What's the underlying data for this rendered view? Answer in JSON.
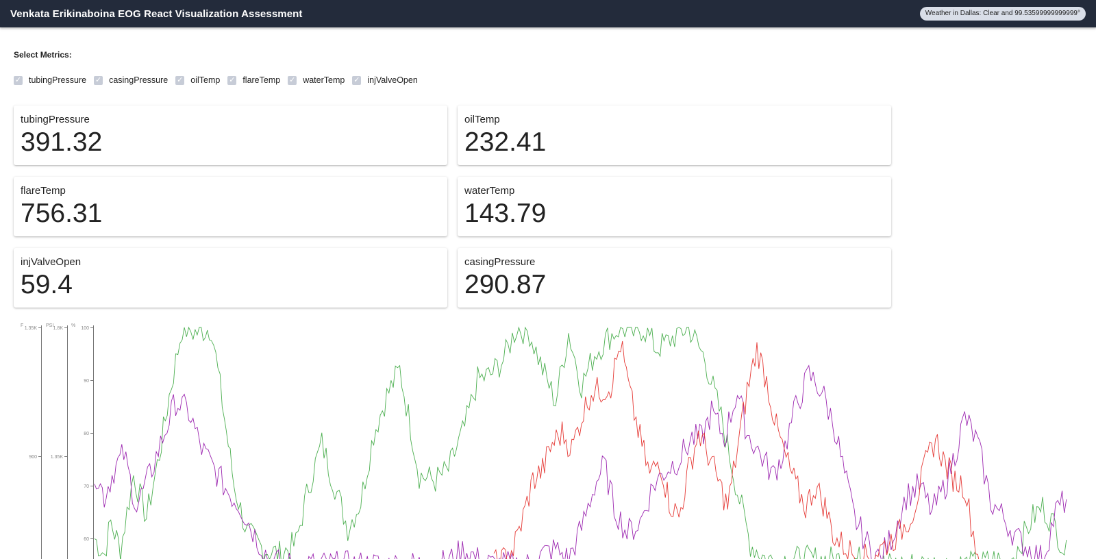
{
  "header": {
    "title": "Venkata Erikinaboina EOG React Visualization Assessment",
    "weather": "Weather in Dallas: Clear and 99.53599999999999°"
  },
  "metric_selector": {
    "label": "Select Metrics:",
    "options": [
      {
        "label": "tubingPressure",
        "checked": true
      },
      {
        "label": "casingPressure",
        "checked": true
      },
      {
        "label": "oilTemp",
        "checked": true
      },
      {
        "label": "flareTemp",
        "checked": true
      },
      {
        "label": "waterTemp",
        "checked": true
      },
      {
        "label": "injValveOpen",
        "checked": true
      }
    ]
  },
  "cards": [
    {
      "title": "tubingPressure",
      "value": "391.32"
    },
    {
      "title": "oilTemp",
      "value": "232.41"
    },
    {
      "title": "flareTemp",
      "value": "756.31"
    },
    {
      "title": "waterTemp",
      "value": "143.79"
    },
    {
      "title": "injValveOpen",
      "value": "59.4"
    },
    {
      "title": "casingPressure",
      "value": "290.87"
    }
  ],
  "colors": {
    "header_bg": "#232b3b",
    "checkbox": "#c7ccd7",
    "series_green": "#4caf50",
    "series_purple": "#9c27b0",
    "series_red": "#e53935"
  },
  "chart_data": {
    "type": "line",
    "axes": [
      {
        "unit": "F",
        "ticks": [
          "1.35K",
          "900"
        ]
      },
      {
        "unit": "PSI",
        "ticks": [
          "1.8K",
          "1.35K"
        ]
      },
      {
        "unit": "%",
        "ticks": [
          "100",
          "90",
          "80",
          "70",
          "60"
        ],
        "ylim": [
          55,
          100
        ]
      }
    ],
    "series": [
      {
        "color": "green",
        "anchors": [
          [
            0,
            60
          ],
          [
            3,
            57
          ],
          [
            5,
            63
          ],
          [
            8,
            58
          ],
          [
            12,
            72
          ],
          [
            16,
            64
          ],
          [
            20,
            76
          ],
          [
            23,
            87
          ],
          [
            27,
            100
          ],
          [
            31,
            99
          ],
          [
            36,
            100
          ],
          [
            40,
            83
          ],
          [
            43,
            70
          ],
          [
            47,
            61
          ],
          [
            52,
            58
          ],
          [
            57,
            57
          ],
          [
            62,
            59
          ],
          [
            66,
            70
          ],
          [
            70,
            78
          ],
          [
            74,
            70
          ],
          [
            78,
            62
          ],
          [
            82,
            67
          ],
          [
            86,
            80
          ],
          [
            90,
            87
          ],
          [
            94,
            92
          ],
          [
            98,
            79
          ],
          [
            100,
            72
          ],
          [
            105,
            71
          ],
          [
            109,
            73
          ],
          [
            114,
            81
          ],
          [
            118,
            90
          ],
          [
            122,
            91
          ],
          [
            126,
            94
          ],
          [
            130,
            100
          ],
          [
            134,
            99
          ],
          [
            138,
            92
          ],
          [
            142,
            86
          ],
          [
            146,
            99
          ],
          [
            150,
            89
          ],
          [
            154,
            95
          ],
          [
            158,
            98
          ],
          [
            162,
            100
          ],
          [
            166,
            99
          ],
          [
            169,
            100
          ],
          [
            173,
            96
          ],
          [
            176,
            97
          ],
          [
            180,
            99
          ],
          [
            183,
            100
          ],
          [
            188,
            94
          ],
          [
            193,
            83
          ],
          [
            198,
            69
          ],
          [
            202,
            59
          ],
          [
            207,
            56
          ],
          [
            212,
            56
          ],
          [
            217,
            56
          ],
          [
            222,
            56
          ],
          [
            228,
            56
          ],
          [
            233,
            56
          ],
          [
            238,
            56
          ],
          [
            243,
            55
          ],
          [
            248,
            55
          ],
          [
            253,
            55
          ],
          [
            258,
            55
          ],
          [
            263,
            55
          ],
          [
            268,
            55
          ],
          [
            273,
            55
          ],
          [
            277,
            56
          ],
          [
            281,
            55
          ],
          [
            285,
            59
          ],
          [
            289,
            64
          ],
          [
            292,
            66
          ],
          [
            296,
            62
          ],
          [
            300,
            56
          ]
        ]
      },
      {
        "color": "purple",
        "anchors": [
          [
            0,
            73
          ],
          [
            3,
            68
          ],
          [
            6,
            73
          ],
          [
            9,
            76
          ],
          [
            13,
            66
          ],
          [
            17,
            72
          ],
          [
            21,
            79
          ],
          [
            25,
            86
          ],
          [
            29,
            84
          ],
          [
            33,
            77
          ],
          [
            37,
            73
          ],
          [
            41,
            69
          ],
          [
            45,
            66
          ],
          [
            50,
            60
          ],
          [
            54,
            56
          ],
          [
            58,
            55
          ],
          [
            62,
            55
          ],
          [
            66,
            55
          ],
          [
            70,
            55
          ],
          [
            74,
            55
          ],
          [
            78,
            55
          ],
          [
            82,
            55
          ],
          [
            86,
            55
          ],
          [
            90,
            55
          ],
          [
            94,
            55
          ],
          [
            98,
            55
          ],
          [
            102,
            55
          ],
          [
            106,
            55
          ],
          [
            110,
            56
          ],
          [
            114,
            58
          ],
          [
            118,
            56
          ],
          [
            122,
            55
          ],
          [
            126,
            55
          ],
          [
            130,
            55
          ],
          [
            134,
            55
          ],
          [
            138,
            57
          ],
          [
            142,
            58
          ],
          [
            146,
            56
          ],
          [
            150,
            62
          ],
          [
            154,
            70
          ],
          [
            157,
            74
          ],
          [
            160,
            66
          ],
          [
            164,
            61
          ],
          [
            168,
            63
          ],
          [
            172,
            70
          ],
          [
            176,
            73
          ],
          [
            180,
            75
          ],
          [
            184,
            79
          ],
          [
            187,
            79
          ],
          [
            190,
            84
          ],
          [
            194,
            79
          ],
          [
            198,
            88
          ],
          [
            201,
            80
          ],
          [
            205,
            76
          ],
          [
            209,
            72
          ],
          [
            212,
            76
          ],
          [
            216,
            85
          ],
          [
            220,
            91
          ],
          [
            224,
            88
          ],
          [
            228,
            81
          ],
          [
            231,
            72
          ],
          [
            234,
            64
          ],
          [
            238,
            59
          ],
          [
            242,
            56
          ],
          [
            246,
            61
          ],
          [
            250,
            68
          ],
          [
            254,
            70
          ],
          [
            258,
            65
          ],
          [
            262,
            70
          ],
          [
            265,
            76
          ],
          [
            268,
            83
          ],
          [
            272,
            78
          ],
          [
            276,
            67
          ],
          [
            280,
            64
          ],
          [
            284,
            60
          ],
          [
            288,
            58
          ],
          [
            292,
            56
          ],
          [
            296,
            65
          ],
          [
            300,
            68
          ]
        ]
      },
      {
        "color": "red",
        "anchors": [
          [
            123,
            55
          ],
          [
            126,
            56
          ],
          [
            129,
            58
          ],
          [
            132,
            64
          ],
          [
            135,
            71
          ],
          [
            138,
            73
          ],
          [
            141,
            78
          ],
          [
            144,
            80
          ],
          [
            147,
            77
          ],
          [
            150,
            83
          ],
          [
            153,
            88
          ],
          [
            156,
            88
          ],
          [
            159,
            89
          ],
          [
            162,
            97
          ],
          [
            165,
            87
          ],
          [
            168,
            79
          ],
          [
            171,
            72
          ],
          [
            174,
            75
          ],
          [
            177,
            67
          ],
          [
            180,
            64
          ],
          [
            183,
            73
          ],
          [
            186,
            80
          ],
          [
            189,
            76
          ],
          [
            192,
            71
          ],
          [
            195,
            66
          ],
          [
            198,
            77
          ],
          [
            201,
            88
          ],
          [
            204,
            96
          ],
          [
            207,
            90
          ],
          [
            210,
            81
          ],
          [
            213,
            75
          ],
          [
            216,
            70
          ],
          [
            219,
            66
          ],
          [
            222,
            70
          ],
          [
            225,
            66
          ],
          [
            228,
            60
          ],
          [
            232,
            58
          ],
          [
            236,
            56
          ],
          [
            240,
            57
          ],
          [
            244,
            59
          ],
          [
            248,
            61
          ],
          [
            252,
            65
          ],
          [
            256,
            74
          ],
          [
            259,
            79
          ],
          [
            262,
            74
          ],
          [
            265,
            71
          ],
          [
            268,
            70
          ],
          [
            270,
            63
          ],
          [
            272,
            57
          ],
          [
            274,
            55
          ]
        ]
      }
    ]
  }
}
